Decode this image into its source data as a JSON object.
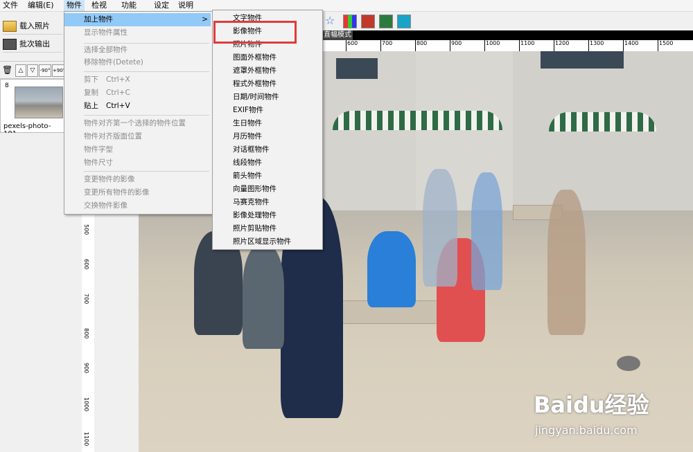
{
  "menubar": {
    "items": [
      "文件",
      "编辑(E)",
      "物件",
      "检视",
      "功能",
      "设定",
      "说明"
    ]
  },
  "left_toolbar": {
    "load_photo": "载入照片",
    "batch_output": "批次输出"
  },
  "controls": {
    "rotate_left": "-90°",
    "rotate_right": "+90°"
  },
  "thumbnail": {
    "number": "8",
    "filename": "pexels-photo-101..."
  },
  "top_strip": {
    "view_mode_label": "直幅模式"
  },
  "ruler_top": {
    "ticks": [
      "600",
      "700",
      "800",
      "900",
      "1000",
      "1100",
      "1200",
      "1300",
      "1400",
      "1500"
    ]
  },
  "ruler_left": {
    "ticks": [
      "500",
      "600",
      "700",
      "800",
      "900",
      "1000",
      "1100"
    ]
  },
  "object_menu": {
    "items": [
      {
        "label": "加上物件",
        "arrow": ">",
        "state": "highlighted"
      },
      {
        "label": "显示物件属性",
        "state": "disabled"
      },
      {
        "label": "选择全部物件",
        "state": "disabled"
      },
      {
        "label": "移除物件(Detete)",
        "state": "disabled"
      },
      {
        "label": "剪下",
        "shortcut": "Ctrl+X",
        "state": "disabled"
      },
      {
        "label": "复制",
        "shortcut": "Ctrl+C",
        "state": "disabled"
      },
      {
        "label": "贴上",
        "shortcut": "Ctrl+V",
        "state": "enabled"
      },
      {
        "label": "物件对齐第一个选择的物件位置",
        "state": "disabled"
      },
      {
        "label": "物件对齐版面位置",
        "state": "disabled"
      },
      {
        "label": "物件字型",
        "state": "disabled"
      },
      {
        "label": "物件尺寸",
        "state": "disabled"
      },
      {
        "label": "变更物件的影像",
        "state": "disabled"
      },
      {
        "label": "变更所有物件的影像",
        "state": "disabled"
      },
      {
        "label": "交换物件影像",
        "state": "disabled"
      }
    ]
  },
  "add_object_submenu": {
    "items": [
      "文字物件",
      "影像物件",
      "照片物件",
      "图面外框物件",
      "遮罩外框物件",
      "程式外框物件",
      "日期/时间物件",
      "EXIF物件",
      "生日物件",
      "月历物件",
      "对话框物件",
      "线段物件",
      "箭头物件",
      "向量图形物件",
      "马赛克物件",
      "影像处理物件",
      "照片剪贴物件",
      "照片区域显示物件"
    ],
    "highlighted_item": "影像物件"
  },
  "watermark": {
    "brand": "Baidu经验",
    "url": "jingyan.baidu.com"
  },
  "colors": {
    "menu_highlight": "#91c9f7",
    "annotation_box": "#e03b3b"
  }
}
